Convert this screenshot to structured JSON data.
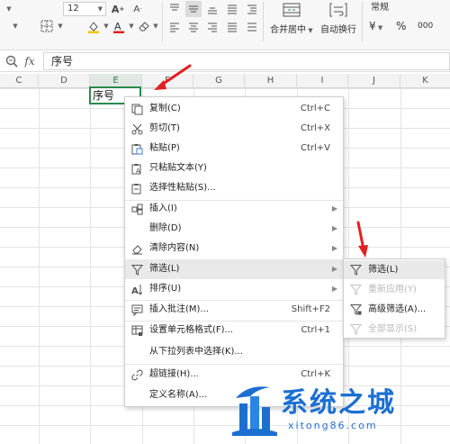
{
  "ribbon": {
    "font_size": "12",
    "number_format": "常规",
    "merge_center_label": "合并居中",
    "wrap_text_label": "自动换行",
    "currency_symbol": "¥",
    "percent_symbol": "%",
    "thousands_symbol": "000"
  },
  "formula_bar": {
    "fx_label": "fx",
    "value": "序号"
  },
  "columns": [
    "C",
    "D",
    "E",
    "F",
    "G",
    "H",
    "I",
    "J",
    "K"
  ],
  "selected_column": "E",
  "active_cell": {
    "address": "E1",
    "value": "序号"
  },
  "context_menu": {
    "items": [
      {
        "label": "复制(C)",
        "shortcut": "Ctrl+C",
        "icon": "copy-icon"
      },
      {
        "label": "剪切(T)",
        "shortcut": "Ctrl+X",
        "icon": "cut-icon"
      },
      {
        "label": "粘贴(P)",
        "shortcut": "Ctrl+V",
        "icon": "paste-icon"
      },
      {
        "label": "只粘贴文本(Y)",
        "shortcut": "",
        "icon": "paste-text-icon"
      },
      {
        "label": "选择性粘贴(S)...",
        "shortcut": "",
        "icon": "paste-special-icon"
      },
      {
        "label": "插入(I)",
        "shortcut": "",
        "icon": "insert-icon",
        "submenu": true
      },
      {
        "label": "删除(D)",
        "shortcut": "",
        "icon": "",
        "submenu": true
      },
      {
        "label": "清除内容(N)",
        "shortcut": "",
        "icon": "clear-icon",
        "submenu": true
      },
      {
        "label": "筛选(L)",
        "shortcut": "",
        "icon": "filter-icon",
        "submenu": true,
        "highlighted": true
      },
      {
        "label": "排序(U)",
        "shortcut": "",
        "icon": "sort-icon",
        "submenu": true
      },
      {
        "label": "插入批注(M)...",
        "shortcut": "Shift+F2",
        "icon": "comment-icon"
      },
      {
        "label": "设置单元格格式(F)...",
        "shortcut": "Ctrl+1",
        "icon": "format-cells-icon"
      },
      {
        "label": "从下拉列表中选择(K)...",
        "shortcut": "",
        "icon": ""
      },
      {
        "label": "超链接(H)...",
        "shortcut": "Ctrl+K",
        "icon": "hyperlink-icon"
      },
      {
        "label": "定义名称(A)...",
        "shortcut": "",
        "icon": ""
      }
    ]
  },
  "filter_submenu": {
    "items": [
      {
        "label": "筛选(L)",
        "enabled": true,
        "highlighted": true
      },
      {
        "label": "重新应用(Y)",
        "enabled": false
      },
      {
        "label": "高级筛选(A)...",
        "enabled": true
      },
      {
        "label": "全部显示(S)",
        "enabled": false
      }
    ]
  },
  "watermark": {
    "title": "系统之城",
    "subtitle": "xitong86.com"
  },
  "colors": {
    "accent_green": "#2b8a4b",
    "annotation_red": "#e32020",
    "watermark_blue": "#1c6fd1"
  }
}
